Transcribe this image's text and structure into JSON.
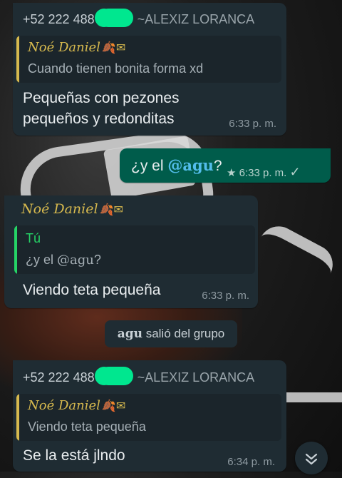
{
  "messages": [
    {
      "sender_phone": "+52 222 488",
      "sender_name": "~ALEXIZ LORANCA",
      "quote": {
        "author": "Noé Daniel",
        "text": "Cuando tienen bonita forma xd"
      },
      "text_line1": "Pequeñas con pezones",
      "text_line2": "pequeños y redonditas",
      "time": "6:33 p. m."
    },
    {
      "outgoing": true,
      "text_prefix": "¿y el ",
      "mention": "@agu",
      "text_suffix": "?",
      "time": "6:33 p. m.",
      "status": "read"
    },
    {
      "sender_name": "Noé Daniel",
      "quote": {
        "author": "Tú",
        "text_prefix": "¿y el ",
        "mention": "@agu",
        "text_suffix": "?"
      },
      "text": "Viendo teta pequeña",
      "time": "6:33 p. m."
    },
    {
      "system_name": "agu",
      "system_text": " salió del grupo"
    },
    {
      "sender_phone": "+52 222 488",
      "sender_name": "~ALEXIZ LORANCA",
      "quote": {
        "author": "Noé Daniel",
        "text": "Viendo teta pequeña"
      },
      "text": "Se la está jlndo",
      "time": "6:34 p. m."
    }
  ],
  "colors": {
    "incoming_bubble": "#1f2c33",
    "outgoing_bubble": "#005c4b",
    "mention": "#53bdeb",
    "quote_author_gold": "#d6b94e",
    "quote_author_you": "#25d366"
  }
}
